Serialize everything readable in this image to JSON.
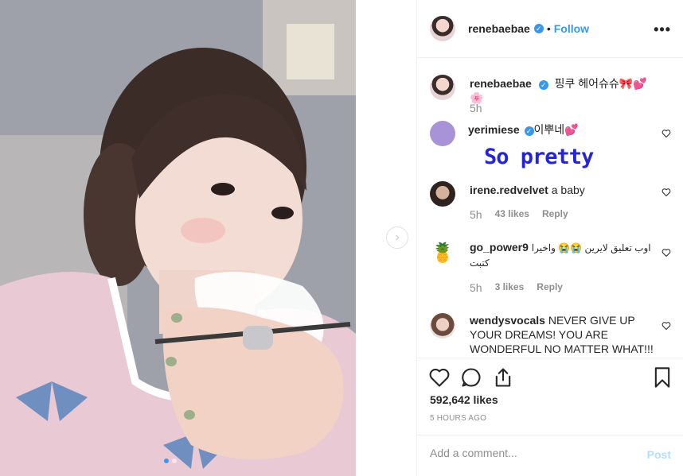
{
  "post": {
    "username": "renebaebae",
    "separator": "•",
    "follow_label": "Follow",
    "more_icon": "more-options-icon",
    "caption": "핑쿠 헤어슈슈🎀💕🌸",
    "caption_time": "5h"
  },
  "comments": [
    {
      "username": "yerimiese",
      "text": "이뿌네💕",
      "annotation": "So pretty"
    },
    {
      "username": "irene.redvelvet",
      "text": "a baby",
      "time": "5h",
      "likes": "43 likes",
      "reply": "Reply"
    },
    {
      "username": "go_power9",
      "text": "اوب تعليق لايرين 😭😭 واخيرا كتبت",
      "time": "5h",
      "likes": "3 likes",
      "reply": "Reply"
    },
    {
      "username": "wendysvocals",
      "text": "NEVER GIVE UP YOUR DREAMS! YOU ARE WONDERFUL NO MATTER WHAT!!!"
    }
  ],
  "footer": {
    "likes": "592,642 likes",
    "time_ago": "5 HOURS AGO",
    "comment_placeholder": "Add a comment...",
    "post_label": "Post"
  },
  "carousel": {
    "slide_count": 2,
    "active_slide": 1
  },
  "colors": {
    "link_blue": "#3897f0",
    "annotation_blue": "#2424d8",
    "post_disabled": "#b2dffc"
  }
}
